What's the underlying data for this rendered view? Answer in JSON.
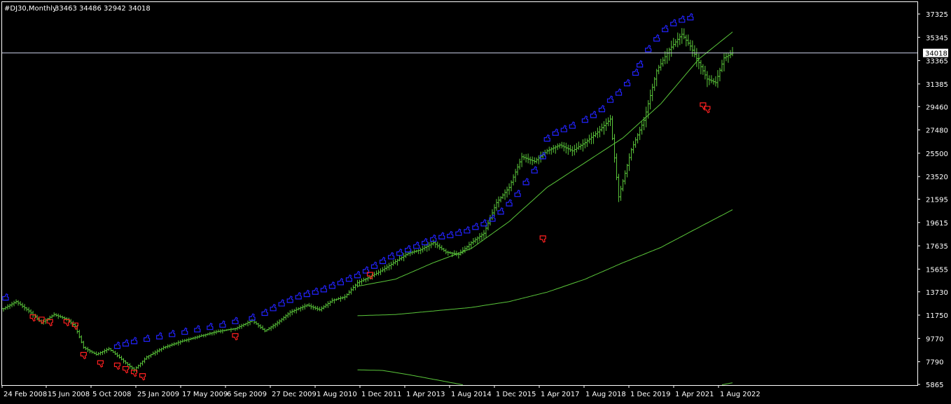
{
  "header": {
    "symbol_label": "#DJ30,Monthly",
    "ohlc_text": "33463 34486 32942 34018"
  },
  "colors": {
    "background": "#000000",
    "frame": "#ffffff",
    "bars": "#5ac63a",
    "moving_average": "#5ac63a",
    "up_marker": "#2323ff",
    "down_marker": "#ff2020",
    "current_price_line": "#c9d1e8",
    "text": "#ffffff"
  },
  "chart_data": {
    "type": "ohlc",
    "title": "#DJ30,Monthly",
    "timeframe": "Monthly",
    "last_ohlc": {
      "open": 33463,
      "high": 34486,
      "low": 32942,
      "close": 34018
    },
    "current_price": 34018,
    "current_price_label": "34018",
    "y_ticks": [
      5865,
      7790,
      9770,
      11750,
      13730,
      15655,
      17635,
      19615,
      21595,
      23520,
      25500,
      27480,
      29460,
      31385,
      33365,
      35345,
      37325
    ],
    "y_tick_labels": [
      "5865",
      "7790",
      "9770",
      "11750",
      "13730",
      "15655",
      "17635",
      "19615",
      "21595",
      "23520",
      "25500",
      "27480",
      "29460",
      "31385",
      "33365",
      "35345",
      "37325"
    ],
    "ylim": [
      5865,
      38200
    ],
    "x_tick_labels": [
      "24 Feb 2008",
      "15 Jun 2008",
      "5 Oct 2008",
      "25 Jan 2009",
      "17 May 2009",
      "6 Sep 2009",
      "27 Dec 2009",
      "1 Aug 2010",
      "1 Dec 2011",
      "1 Apr 2013",
      "1 Aug 2014",
      "1 Dec 2015",
      "1 Apr 2017",
      "1 Aug 2018",
      "1 Dec 2019",
      "1 Apr 2021",
      "1 Aug 2022"
    ],
    "price_anchors": [
      {
        "i": 0,
        "p": 12300
      },
      {
        "i": 6,
        "p": 12900
      },
      {
        "i": 12,
        "p": 12100
      },
      {
        "i": 18,
        "p": 11100
      },
      {
        "i": 24,
        "p": 11800
      },
      {
        "i": 30,
        "p": 11400
      },
      {
        "i": 34,
        "p": 10800
      },
      {
        "i": 38,
        "p": 9000
      },
      {
        "i": 44,
        "p": 8400
      },
      {
        "i": 50,
        "p": 8900
      },
      {
        "i": 56,
        "p": 8000
      },
      {
        "i": 62,
        "p": 7100
      },
      {
        "i": 68,
        "p": 8200
      },
      {
        "i": 76,
        "p": 9000
      },
      {
        "i": 84,
        "p": 9500
      },
      {
        "i": 92,
        "p": 9900
      },
      {
        "i": 100,
        "p": 10300
      },
      {
        "i": 106,
        "p": 10500
      },
      {
        "i": 110,
        "p": 10600
      },
      {
        "i": 118,
        "p": 11300
      },
      {
        "i": 124,
        "p": 10400
      },
      {
        "i": 130,
        "p": 11100
      },
      {
        "i": 136,
        "p": 12000
      },
      {
        "i": 144,
        "p": 12600
      },
      {
        "i": 150,
        "p": 12200
      },
      {
        "i": 156,
        "p": 13000
      },
      {
        "i": 162,
        "p": 13300
      },
      {
        "i": 168,
        "p": 14500
      },
      {
        "i": 174,
        "p": 15000
      },
      {
        "i": 180,
        "p": 15600
      },
      {
        "i": 186,
        "p": 16300
      },
      {
        "i": 192,
        "p": 17000
      },
      {
        "i": 198,
        "p": 17300
      },
      {
        "i": 204,
        "p": 17900
      },
      {
        "i": 210,
        "p": 17100
      },
      {
        "i": 216,
        "p": 16900
      },
      {
        "i": 222,
        "p": 17900
      },
      {
        "i": 228,
        "p": 18700
      },
      {
        "i": 234,
        "p": 21300
      },
      {
        "i": 240,
        "p": 22600
      },
      {
        "i": 246,
        "p": 25200
      },
      {
        "i": 252,
        "p": 24800
      },
      {
        "i": 258,
        "p": 25700
      },
      {
        "i": 264,
        "p": 26200
      },
      {
        "i": 270,
        "p": 25700
      },
      {
        "i": 276,
        "p": 26400
      },
      {
        "i": 282,
        "p": 27300
      },
      {
        "i": 288,
        "p": 28400
      },
      {
        "i": 292,
        "p": 21800
      },
      {
        "i": 298,
        "p": 25800
      },
      {
        "i": 304,
        "p": 28300
      },
      {
        "i": 310,
        "p": 32500
      },
      {
        "i": 316,
        "p": 34300
      },
      {
        "i": 322,
        "p": 35600
      },
      {
        "i": 326,
        "p": 34600
      },
      {
        "i": 330,
        "p": 33200
      },
      {
        "i": 334,
        "p": 31800
      },
      {
        "i": 338,
        "p": 31500
      },
      {
        "i": 342,
        "p": 33600
      },
      {
        "i": 346,
        "p": 34018
      }
    ],
    "ma_fast_anchors": [
      {
        "i": 168,
        "p": 14200
      },
      {
        "i": 186,
        "p": 14800
      },
      {
        "i": 204,
        "p": 16200
      },
      {
        "i": 222,
        "p": 17400
      },
      {
        "i": 240,
        "p": 19700
      },
      {
        "i": 258,
        "p": 22600
      },
      {
        "i": 276,
        "p": 24700
      },
      {
        "i": 294,
        "p": 26800
      },
      {
        "i": 312,
        "p": 29700
      },
      {
        "i": 330,
        "p": 33500
      },
      {
        "i": 346,
        "p": 35800
      }
    ],
    "ma_slow_anchors": [
      {
        "i": 168,
        "p": 11700
      },
      {
        "i": 186,
        "p": 11800
      },
      {
        "i": 204,
        "p": 12100
      },
      {
        "i": 222,
        "p": 12400
      },
      {
        "i": 240,
        "p": 12900
      },
      {
        "i": 258,
        "p": 13700
      },
      {
        "i": 276,
        "p": 14800
      },
      {
        "i": 294,
        "p": 16200
      },
      {
        "i": 312,
        "p": 17500
      },
      {
        "i": 330,
        "p": 19200
      },
      {
        "i": 346,
        "p": 20700
      }
    ],
    "ma_slower_anchors": [
      {
        "i": 168,
        "p": 7100
      },
      {
        "i": 180,
        "p": 7050
      },
      {
        "i": 192,
        "p": 6700
      },
      {
        "i": 204,
        "p": 6300
      },
      {
        "i": 216,
        "p": 5900
      },
      {
        "i": 240,
        "p": 5000
      },
      {
        "i": 300,
        "p": 3500
      },
      {
        "i": 340,
        "p": 5800
      },
      {
        "i": 346,
        "p": 6000
      }
    ],
    "blue_arrow_up_markers": [
      {
        "i": 1,
        "p": 13200
      },
      {
        "i": 54,
        "p": 9100
      },
      {
        "i": 58,
        "p": 9300
      },
      {
        "i": 62,
        "p": 9500
      },
      {
        "i": 68,
        "p": 9700
      },
      {
        "i": 74,
        "p": 9900
      },
      {
        "i": 80,
        "p": 10100
      },
      {
        "i": 86,
        "p": 10300
      },
      {
        "i": 92,
        "p": 10500
      },
      {
        "i": 98,
        "p": 10700
      },
      {
        "i": 104,
        "p": 10900
      },
      {
        "i": 110,
        "p": 11200
      },
      {
        "i": 118,
        "p": 11500
      },
      {
        "i": 124,
        "p": 11900
      },
      {
        "i": 128,
        "p": 12300
      },
      {
        "i": 132,
        "p": 12700
      },
      {
        "i": 136,
        "p": 13000
      },
      {
        "i": 140,
        "p": 13300
      },
      {
        "i": 144,
        "p": 13500
      },
      {
        "i": 148,
        "p": 13700
      },
      {
        "i": 152,
        "p": 13900
      },
      {
        "i": 156,
        "p": 14200
      },
      {
        "i": 160,
        "p": 14500
      },
      {
        "i": 164,
        "p": 14800
      },
      {
        "i": 168,
        "p": 15100
      },
      {
        "i": 172,
        "p": 15500
      },
      {
        "i": 176,
        "p": 15900
      },
      {
        "i": 180,
        "p": 16300
      },
      {
        "i": 184,
        "p": 16700
      },
      {
        "i": 188,
        "p": 17000
      },
      {
        "i": 192,
        "p": 17300
      },
      {
        "i": 196,
        "p": 17600
      },
      {
        "i": 200,
        "p": 17900
      },
      {
        "i": 204,
        "p": 18200
      },
      {
        "i": 208,
        "p": 18400
      },
      {
        "i": 212,
        "p": 18500
      },
      {
        "i": 216,
        "p": 18700
      },
      {
        "i": 220,
        "p": 18900
      },
      {
        "i": 224,
        "p": 19200
      },
      {
        "i": 228,
        "p": 19500
      },
      {
        "i": 232,
        "p": 19900
      },
      {
        "i": 236,
        "p": 20500
      },
      {
        "i": 240,
        "p": 21200
      },
      {
        "i": 244,
        "p": 22000
      },
      {
        "i": 248,
        "p": 23000
      },
      {
        "i": 252,
        "p": 24000
      },
      {
        "i": 256,
        "p": 25200
      },
      {
        "i": 258,
        "p": 26700
      },
      {
        "i": 262,
        "p": 27200
      },
      {
        "i": 266,
        "p": 27500
      },
      {
        "i": 270,
        "p": 27800
      },
      {
        "i": 276,
        "p": 28300
      },
      {
        "i": 280,
        "p": 28700
      },
      {
        "i": 284,
        "p": 29200
      },
      {
        "i": 288,
        "p": 30000
      },
      {
        "i": 292,
        "p": 30600
      },
      {
        "i": 296,
        "p": 31400
      },
      {
        "i": 300,
        "p": 32300
      },
      {
        "i": 302,
        "p": 33000
      },
      {
        "i": 306,
        "p": 34300
      },
      {
        "i": 310,
        "p": 35200
      },
      {
        "i": 314,
        "p": 36000
      },
      {
        "i": 318,
        "p": 36500
      },
      {
        "i": 322,
        "p": 36800
      },
      {
        "i": 326,
        "p": 37000
      }
    ],
    "red_arrow_down_markers": [
      {
        "i": 14,
        "p": 11600
      },
      {
        "i": 18,
        "p": 11400
      },
      {
        "i": 22,
        "p": 11200
      },
      {
        "i": 30,
        "p": 11200
      },
      {
        "i": 34,
        "p": 10900
      },
      {
        "i": 38,
        "p": 8400
      },
      {
        "i": 46,
        "p": 7700
      },
      {
        "i": 54,
        "p": 7500
      },
      {
        "i": 58,
        "p": 7200
      },
      {
        "i": 62,
        "p": 6900
      },
      {
        "i": 66,
        "p": 6600
      },
      {
        "i": 110,
        "p": 10000
      },
      {
        "i": 174,
        "p": 15200
      },
      {
        "i": 256,
        "p": 18300
      },
      {
        "i": 332,
        "p": 29600
      },
      {
        "i": 334,
        "p": 29300
      }
    ]
  }
}
